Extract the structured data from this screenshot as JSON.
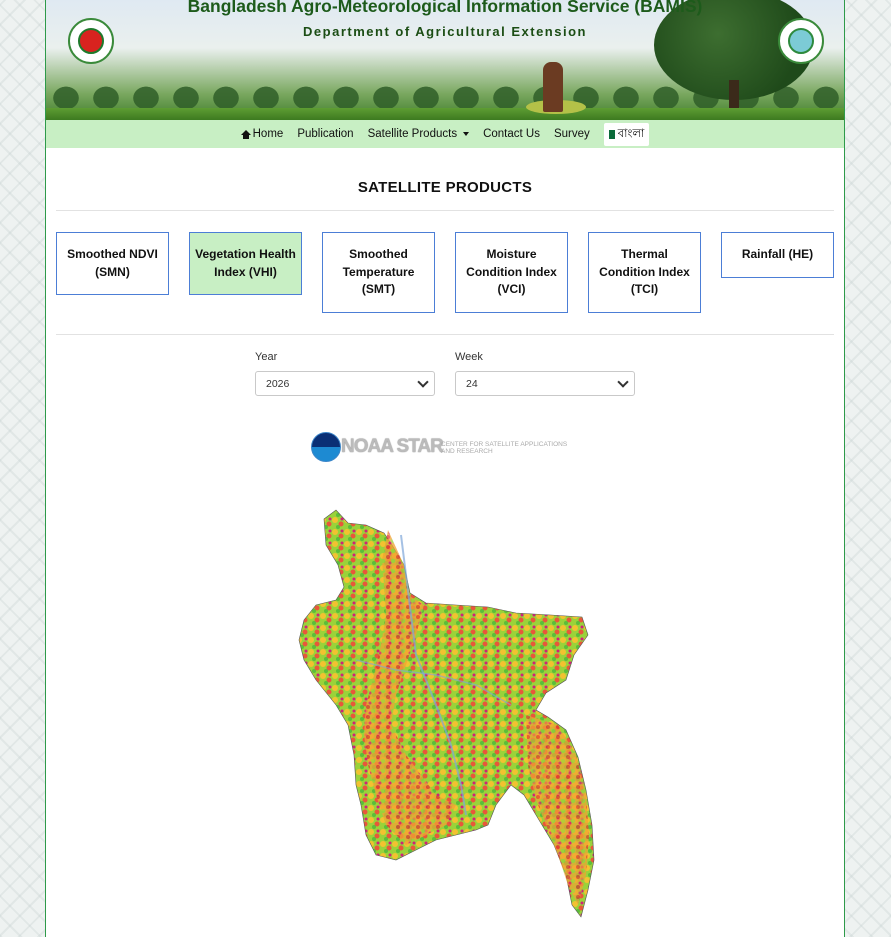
{
  "header": {
    "title": "Bangladesh Agro-Meteorological Information Service (BAMIS)",
    "subtitle": "Department of Agricultural Extension"
  },
  "nav": {
    "items": [
      {
        "label": "Home",
        "icon": "home-icon"
      },
      {
        "label": "Publication"
      },
      {
        "label": "Satellite Products",
        "icon": "caret-down-icon"
      },
      {
        "label": "Contact Us"
      },
      {
        "label": "Survey"
      }
    ],
    "language": "বাংলা"
  },
  "section": {
    "title": "SATELLITE PRODUCTS"
  },
  "products": [
    {
      "label": "Smoothed NDVI (SMN)",
      "active": false
    },
    {
      "label": "Vegetation Health Index (VHI)",
      "active": true
    },
    {
      "label": "Smoothed Temperature (SMT)",
      "active": false
    },
    {
      "label": "Moisture Condition Index (VCI)",
      "active": false
    },
    {
      "label": "Thermal Condition Index (TCI)",
      "active": false
    },
    {
      "label": "Rainfall (HE)",
      "active": false
    }
  ],
  "filters": {
    "year_label": "Year",
    "year_value": "2026",
    "week_label": "Week",
    "week_value": "24"
  },
  "noaa": {
    "badge": "NOAA",
    "brand": "NOAA STAR",
    "subtitle": "CENTER FOR SATELLITE APPLICATIONS AND RESEARCH"
  },
  "colors": {
    "nav_bg": "#c8efc4",
    "accent_green": "#2e9a4a",
    "card_border": "#4c7ed6"
  }
}
